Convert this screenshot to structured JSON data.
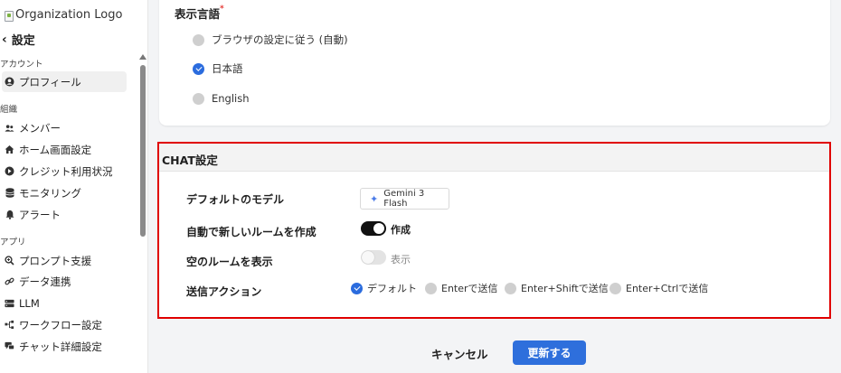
{
  "sidebar": {
    "logo_alt": "Organization Logo",
    "back_label": "設定",
    "sections": [
      {
        "label": "アカウント",
        "items": [
          {
            "label": "プロフィール",
            "icon": "user-circle-icon"
          }
        ]
      },
      {
        "label": "組織",
        "items": [
          {
            "label": "メンバー",
            "icon": "users-icon"
          },
          {
            "label": "ホーム画面設定",
            "icon": "home-icon"
          },
          {
            "label": "クレジット利用状況",
            "icon": "credit-icon"
          },
          {
            "label": "モニタリング",
            "icon": "database-icon"
          },
          {
            "label": "アラート",
            "icon": "bell-icon"
          }
        ]
      },
      {
        "label": "アプリ",
        "items": [
          {
            "label": "プロンプト支援",
            "icon": "prompt-icon"
          },
          {
            "label": "データ連携",
            "icon": "link-icon"
          },
          {
            "label": "LLM",
            "icon": "server-icon"
          },
          {
            "label": "ワークフロー設定",
            "icon": "workflow-icon"
          },
          {
            "label": "チャット詳細設定",
            "icon": "chat-icon"
          }
        ]
      }
    ]
  },
  "language": {
    "title": "表示言語",
    "required_mark": "*",
    "options": [
      {
        "label": "ブラウザの設定に従う (自動)",
        "checked": false
      },
      {
        "label": "日本語",
        "checked": true
      },
      {
        "label": "English",
        "checked": false
      }
    ]
  },
  "chat": {
    "title": "CHAT設定",
    "default_model_label": "デフォルトのモデル",
    "default_model_value": "Gemini 3 Flash",
    "auto_room_label": "自動で新しいルームを作成",
    "auto_room_toggle_label": "作成",
    "auto_room_on": true,
    "show_empty_label": "空のルームを表示",
    "show_empty_toggle_label": "表示",
    "show_empty_on": false,
    "send_action_label": "送信アクション",
    "send_options": [
      {
        "label": "デフォルト",
        "checked": true
      },
      {
        "label": "Enterで送信",
        "checked": false
      },
      {
        "label": "Enter+Shiftで送信",
        "checked": false
      },
      {
        "label": "Enter+Ctrlで送信",
        "checked": false
      }
    ]
  },
  "footer": {
    "cancel_label": "キャンセル",
    "update_label": "更新する"
  },
  "colors": {
    "accent": "#2e6fdc",
    "highlight_border": "#e00000"
  }
}
